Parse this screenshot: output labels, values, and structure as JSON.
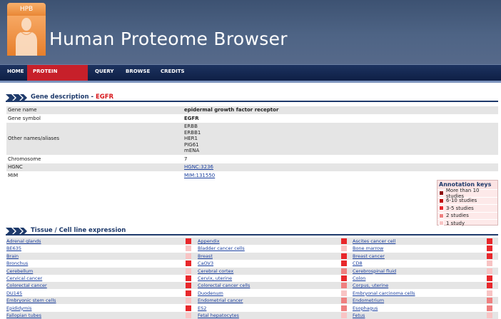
{
  "header": {
    "logo_text": "HPB",
    "title": "Human Proteome Browser"
  },
  "nav": {
    "items": [
      {
        "label": "HOME",
        "active": false
      },
      {
        "label": "PROTEIN SUMMARY",
        "active": true
      },
      {
        "label": "QUERY",
        "active": false
      },
      {
        "label": "BROWSE",
        "active": false
      },
      {
        "label": "CREDITS",
        "active": false
      }
    ]
  },
  "gene_section": {
    "title": "Gene description - ",
    "gene": "EGFR"
  },
  "gene_table": {
    "gene_name_label": "Gene name",
    "gene_name": "epidermal growth factor receptor",
    "gene_symbol_label": "Gene symbol",
    "gene_symbol": "EGFR",
    "aliases_label": "Other names/aliases",
    "aliases": [
      "ERBB",
      "ERBB1",
      "HER1",
      "PIG61",
      "mENA"
    ],
    "chromosome_label": "Chromosome",
    "chromosome": "7",
    "hgnc_label": "HGNC",
    "hgnc": "HGNC:3236",
    "mim_label": "MIM",
    "mim": "MIM:131550"
  },
  "annotation_keys": {
    "title": "Annotation keys",
    "items": [
      {
        "label": "More than 10 studies",
        "color": "#8b0000"
      },
      {
        "label": "6-10 studies",
        "color": "#c00000"
      },
      {
        "label": "3-5 studies",
        "color": "#e8272b"
      },
      {
        "label": "2 studies",
        "color": "#ef7f7f"
      },
      {
        "label": "1 study",
        "color": "#f8c4c4"
      }
    ]
  },
  "tissue_section": {
    "title": "Tissue / Cell line expression"
  },
  "tissues": [
    [
      {
        "name": "Adrenal glands",
        "color": "#e8272b"
      },
      {
        "name": "Appendix",
        "color": "#e8272b"
      },
      {
        "name": "Ascites cancer cell",
        "color": "#e8272b"
      }
    ],
    [
      {
        "name": "BE635",
        "color": "#f8c4c4"
      },
      {
        "name": "Bladder cancer cells",
        "color": "#f8c4c4"
      },
      {
        "name": "Bone marrow",
        "color": "#e8272b"
      }
    ],
    [
      {
        "name": "Brain",
        "color": "#f8c4c4"
      },
      {
        "name": "Breast",
        "color": "#e8272b"
      },
      {
        "name": "Breast cancer",
        "color": "#e8272b"
      }
    ],
    [
      {
        "name": "Bronchus",
        "color": "#e8272b"
      },
      {
        "name": "CaOV3",
        "color": "#e8272b"
      },
      {
        "name": "CD8",
        "color": "#f8c4c4"
      }
    ],
    [
      {
        "name": "Cerebellum",
        "color": "#f8c4c4"
      },
      {
        "name": "Cerebral cortex",
        "color": "#ef7f7f"
      },
      {
        "name": "Cerebrospinal fluid",
        "color": "#f8c4c4"
      }
    ],
    [
      {
        "name": "Cervical cancer",
        "color": "#e8272b"
      },
      {
        "name": "Cervix, uterine",
        "color": "#e8272b"
      },
      {
        "name": "Colon",
        "color": "#e8272b"
      }
    ],
    [
      {
        "name": "Colorectal cancer",
        "color": "#e8272b"
      },
      {
        "name": "Colorectal cancer cells",
        "color": "#ef7f7f"
      },
      {
        "name": "Corpus, uterine",
        "color": "#e8272b"
      }
    ],
    [
      {
        "name": "DU145",
        "color": "#e8272b"
      },
      {
        "name": "Duodenum",
        "color": "#f8c4c4"
      },
      {
        "name": "Embryonal carcinoma cells",
        "color": "#f8c4c4"
      }
    ],
    [
      {
        "name": "Embryonic stem cells",
        "color": "#f8c4c4"
      },
      {
        "name": "Endometrial cancer",
        "color": "#ef7f7f"
      },
      {
        "name": "Endometrium",
        "color": "#ef7f7f"
      }
    ],
    [
      {
        "name": "Epididymis",
        "color": "#e8272b"
      },
      {
        "name": "ES2",
        "color": "#ef7f7f"
      },
      {
        "name": "Esophagus",
        "color": "#ef7f7f"
      }
    ],
    [
      {
        "name": "Fallopian tubes",
        "color": "#f8c4c4"
      },
      {
        "name": "Fetal hepatocytes",
        "color": "#f8c4c4"
      },
      {
        "name": "Fetus",
        "color": "#f8c4c4"
      }
    ]
  ]
}
